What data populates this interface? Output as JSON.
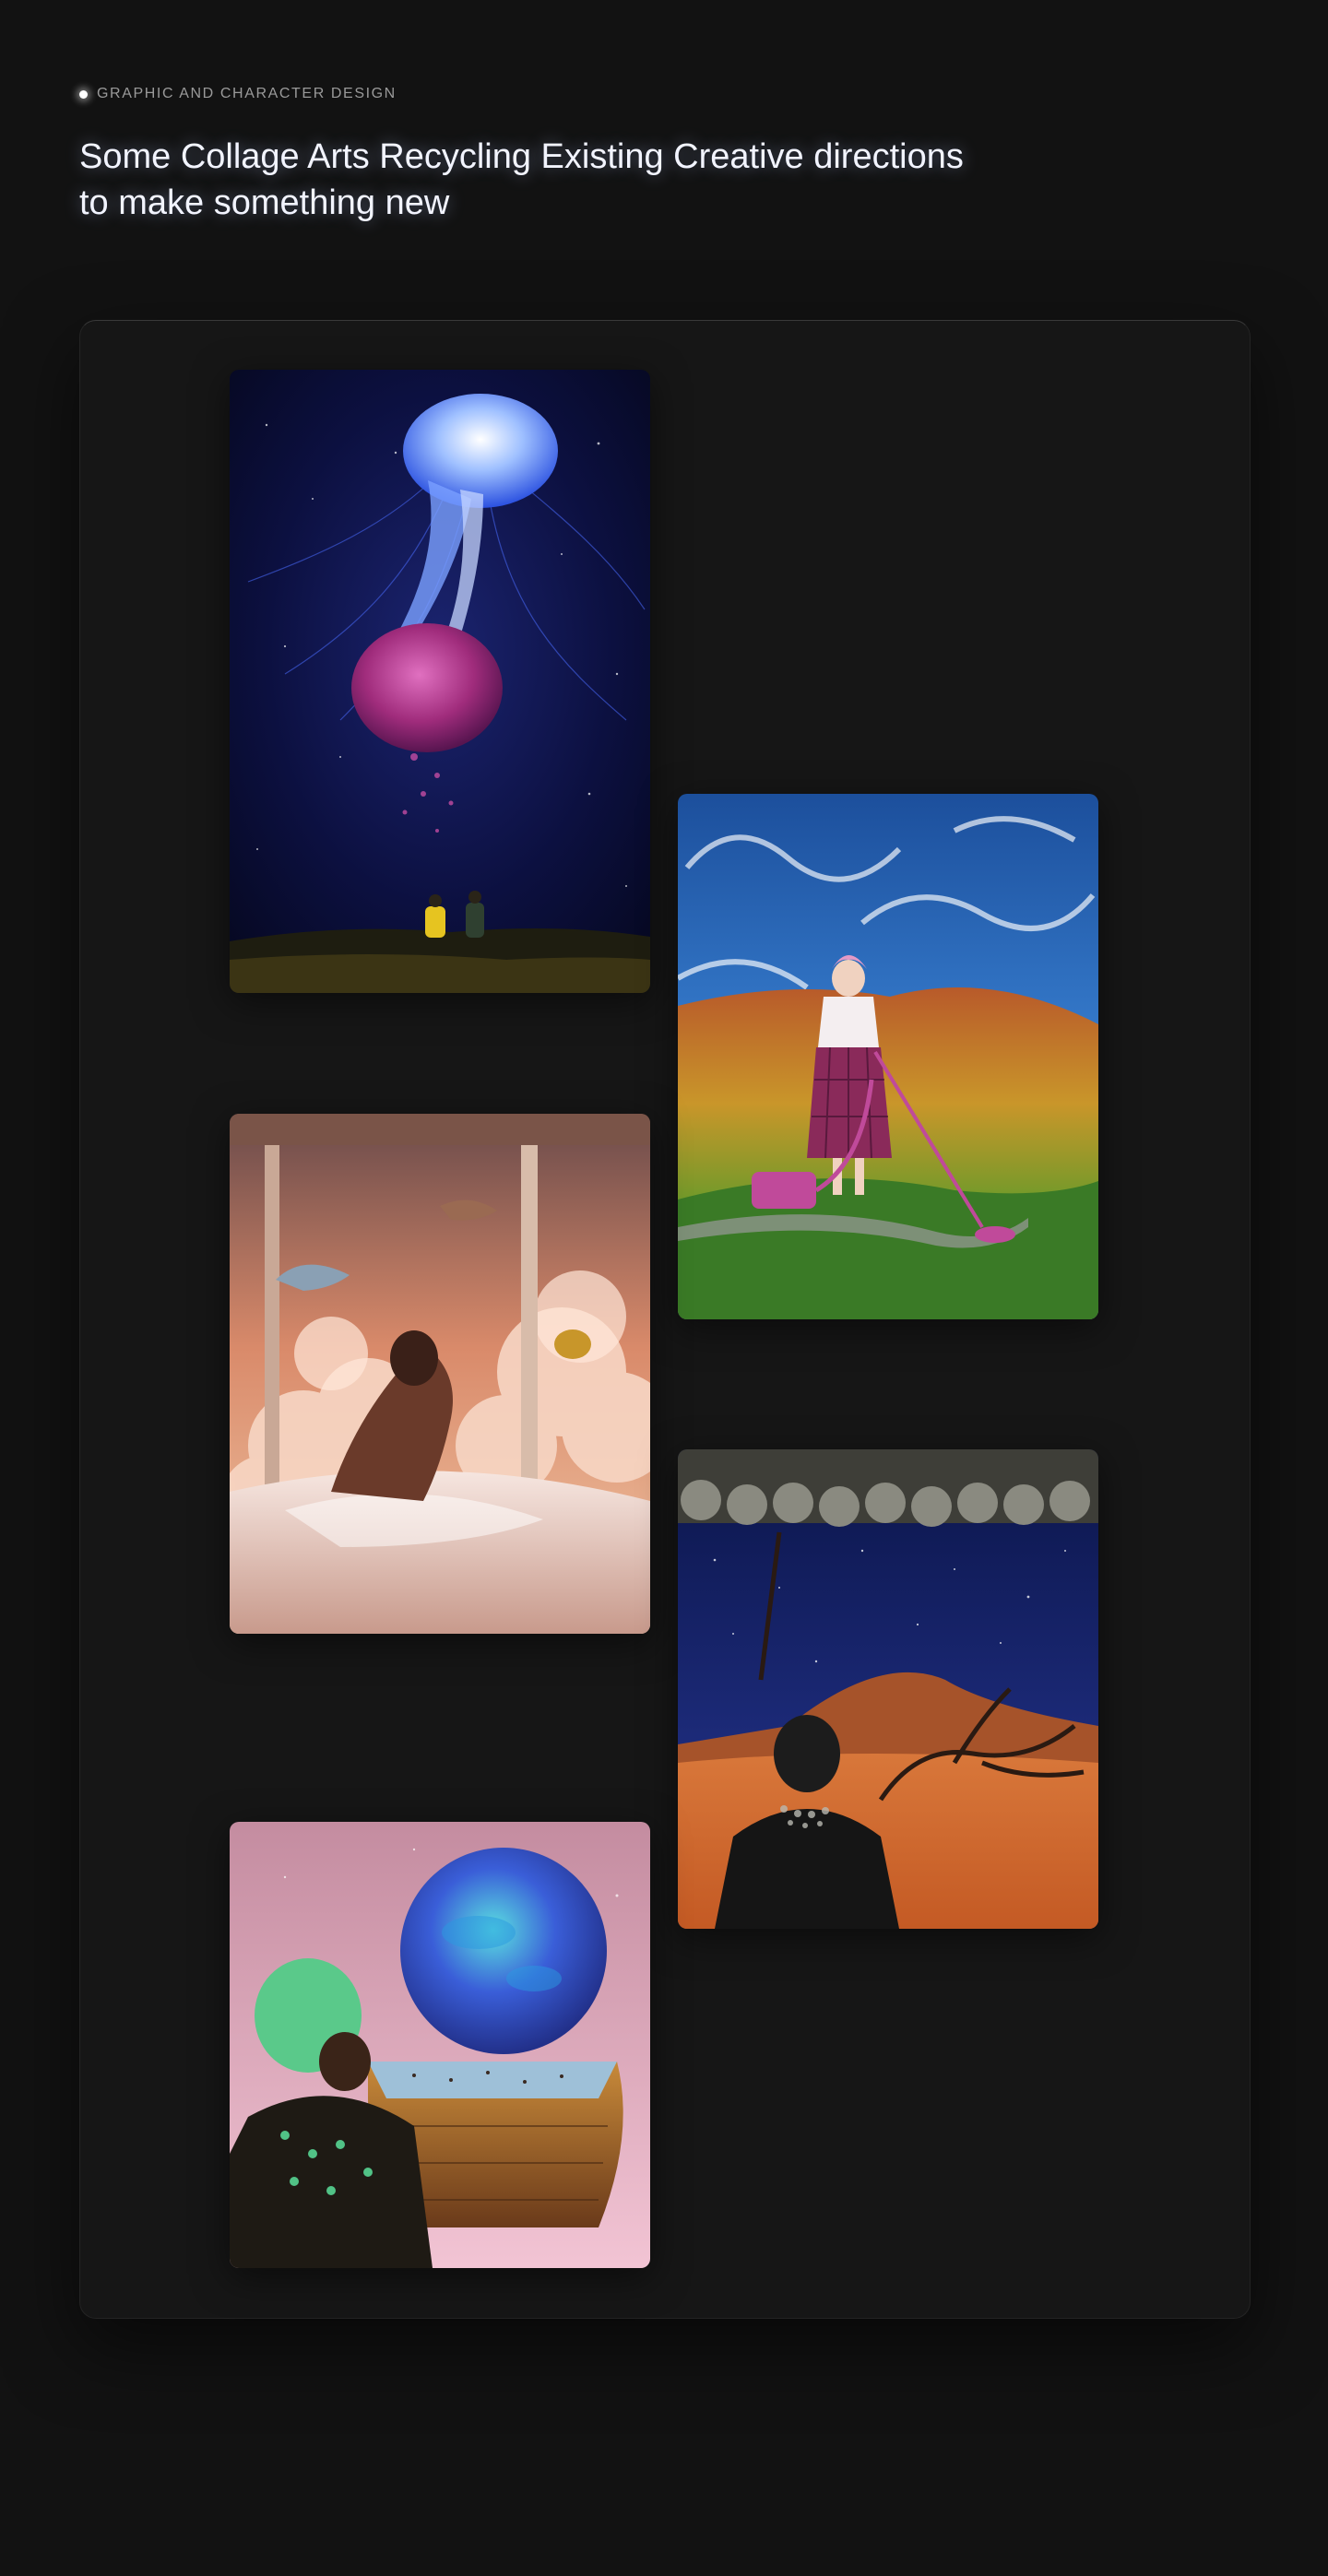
{
  "header": {
    "eyebrow": "GRAPHIC AND CHARACTER DESIGN",
    "title": "Some Collage Arts Recycling Existing Creative directions to make something new"
  },
  "gallery": {
    "images": [
      {
        "name": "jellyfish-night-sky-collage"
      },
      {
        "name": "vacuum-woman-ocean-hills-collage"
      },
      {
        "name": "bedroom-clouds-dolphins-collage"
      },
      {
        "name": "desert-starry-night-figure-collage"
      },
      {
        "name": "planet-boat-woman-collage"
      }
    ]
  },
  "colors": {
    "background": "#121212",
    "panel": "#161616",
    "title": "#f2f4ff",
    "eyebrow": "#9a9a9a"
  }
}
